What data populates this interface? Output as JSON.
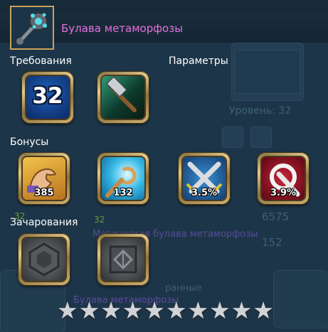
{
  "item": {
    "title": "Булава метаморфозы",
    "icon": "mace-icon"
  },
  "sections": {
    "requirements": "Требования",
    "parameters": "Параметры",
    "bonuses": "Бонусы",
    "enchantments": "Зачарования"
  },
  "requirements": {
    "level": "32"
  },
  "parameters": {
    "weapon_type_icon": "hammer-icon"
  },
  "bonuses": [
    {
      "icon": "strength-arm-icon",
      "value": "385"
    },
    {
      "icon": "staff-scroll-icon",
      "value": "132"
    },
    {
      "icon": "crossed-swords-icon",
      "value": "3.5%"
    },
    {
      "icon": "crit-sword-icon",
      "value": "3.9%"
    }
  ],
  "enchantments": [
    {
      "icon": "empty-rune-slot-icon"
    },
    {
      "icon": "rune-glyph-icon"
    }
  ],
  "stars": {
    "total": 10
  },
  "background": {
    "level_text": "Уровень: 32",
    "item_name_faded": "Магическая булава метаморфозы",
    "value_a": "6575",
    "value_b": "152",
    "faded_a": "32",
    "faded_b": "32",
    "faded_c": "Булава метаморфозы",
    "faded_d": "ранные"
  },
  "colors": {
    "title": "#e86fe0",
    "frame_gold": "#e2c98b",
    "background": "#1d3548"
  }
}
